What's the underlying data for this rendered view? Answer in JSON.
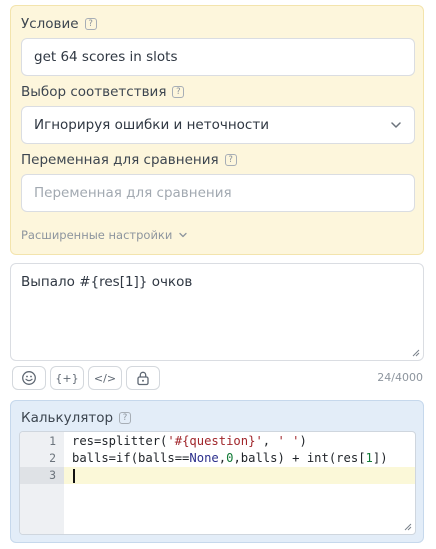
{
  "condition": {
    "label": "Условие",
    "value": "get 64 scores in slots"
  },
  "match": {
    "label": "Выбор соответствия",
    "selected": "Игнорируя ошибки и неточности"
  },
  "compare_var": {
    "label": "Переменная для сравнения",
    "placeholder": "Переменная для сравнения"
  },
  "advanced": {
    "label": "Расширенные настройки"
  },
  "message": {
    "text": "Выпало #{res[1]} очков",
    "counter": "24/4000"
  },
  "toolbar": {
    "buttons": [
      {
        "icon": "emoji-icon"
      },
      {
        "icon": "variable-icon",
        "label": "{+}"
      },
      {
        "icon": "code-icon",
        "label": "</>"
      },
      {
        "icon": "lock-icon"
      }
    ]
  },
  "calculator": {
    "title": "Калькулятор",
    "lines": [
      {
        "num": "1",
        "code": "res=splitter('#{question}', ' ')"
      },
      {
        "num": "2",
        "code": "balls=if(balls==None,0,balls) + int(res[1])"
      },
      {
        "num": "3",
        "code": ""
      }
    ]
  },
  "colors": {
    "condition_bg": "#fdf6dc",
    "calculator_bg": "#e3edf8",
    "active_line": "#fbf8d8"
  }
}
